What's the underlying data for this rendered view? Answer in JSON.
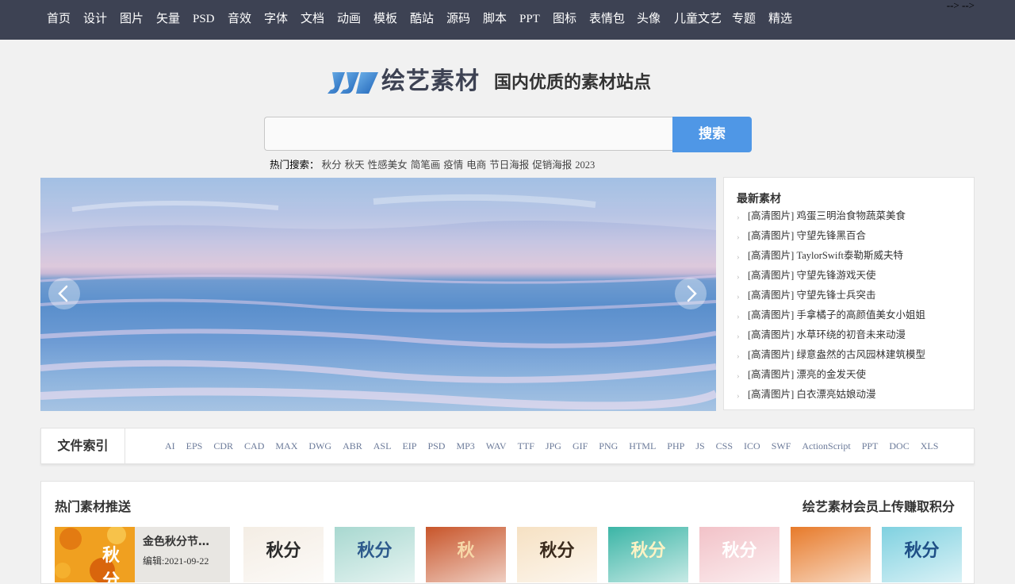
{
  "nav": {
    "items": [
      "首页",
      "设计",
      "图片",
      "矢量",
      "PSD",
      "音效",
      "字体",
      "文档",
      "动画",
      "模板",
      "酷站",
      "源码",
      "脚本",
      "PPT",
      "图标",
      "表情包",
      "头像",
      "儿童文艺",
      "专题",
      "精选"
    ],
    "stray_text": "--> -->"
  },
  "header": {
    "logo_text": "绘艺素材",
    "slogan": "国内优质的素材站点"
  },
  "search": {
    "placeholder": "",
    "value": "",
    "button_label": "搜索",
    "hot_label": "热门搜索：",
    "hot_words": [
      "秋分",
      "秋天",
      "性感美女",
      "简笔画",
      "疫情",
      "电商",
      "节日海报",
      "促销海报",
      "2023"
    ]
  },
  "banner": {
    "prev_icon": "chevron-left-icon",
    "next_icon": "chevron-right-icon"
  },
  "latest": {
    "title": "最新素材",
    "items": [
      "[高清图片] 鸡蛋三明治食物蔬菜美食",
      "[高清图片] 守望先锋黑百合",
      "[高清图片] TaylorSwift泰勒斯威夫特",
      "[高清图片] 守望先锋游戏天使",
      "[高清图片] 守望先锋士兵突击",
      "[高清图片] 手拿橘子的高颜值美女小姐姐",
      "[高清图片] 水草环绕的初音未来动漫",
      "[高清图片] 绿意盎然的古风园林建筑模型",
      "[高清图片] 漂亮的金发天使",
      "[高清图片] 白衣漂亮姑娘动漫"
    ]
  },
  "file_index": {
    "title": "文件索引",
    "links": [
      "AI",
      "EPS",
      "CDR",
      "CAD",
      "MAX",
      "DWG",
      "ABR",
      "ASL",
      "EIP",
      "PSD",
      "MP3",
      "WAV",
      "TTF",
      "JPG",
      "GIF",
      "PNG",
      "HTML",
      "PHP",
      "JS",
      "CSS",
      "ICO",
      "SWF",
      "ActionScript",
      "PPT",
      "DOC",
      "XLS"
    ]
  },
  "recommend": {
    "title": "热门素材推送",
    "right_link": "绘艺素材会员上传赚取积分",
    "featured": {
      "name": "金色秋分节…",
      "date": "编辑:2021-09-22",
      "thumb_text": "秋分"
    },
    "thumbs": [
      {
        "text": "秋分",
        "bg": "#f4ede4",
        "fg": "#2b2b2b"
      },
      {
        "text": "秋分",
        "bg": "#a8d8d0",
        "fg": "#2d5a8c"
      },
      {
        "text": "秋",
        "bg": "#c8552a",
        "fg": "#f7d8a8"
      },
      {
        "text": "秋分",
        "bg": "#f6e1c3",
        "fg": "#3a2a1c"
      },
      {
        "text": "秋分",
        "bg": "#3bb5a6",
        "fg": "#fff3c4"
      },
      {
        "text": "秋分",
        "bg": "#f2c2c8",
        "fg": "#ffffff"
      },
      {
        "text": "",
        "bg": "#e77a2a",
        "fg": "#ffffff"
      },
      {
        "text": "秋分",
        "bg": "#7fd1e0",
        "fg": "#1e4f86"
      }
    ]
  }
}
